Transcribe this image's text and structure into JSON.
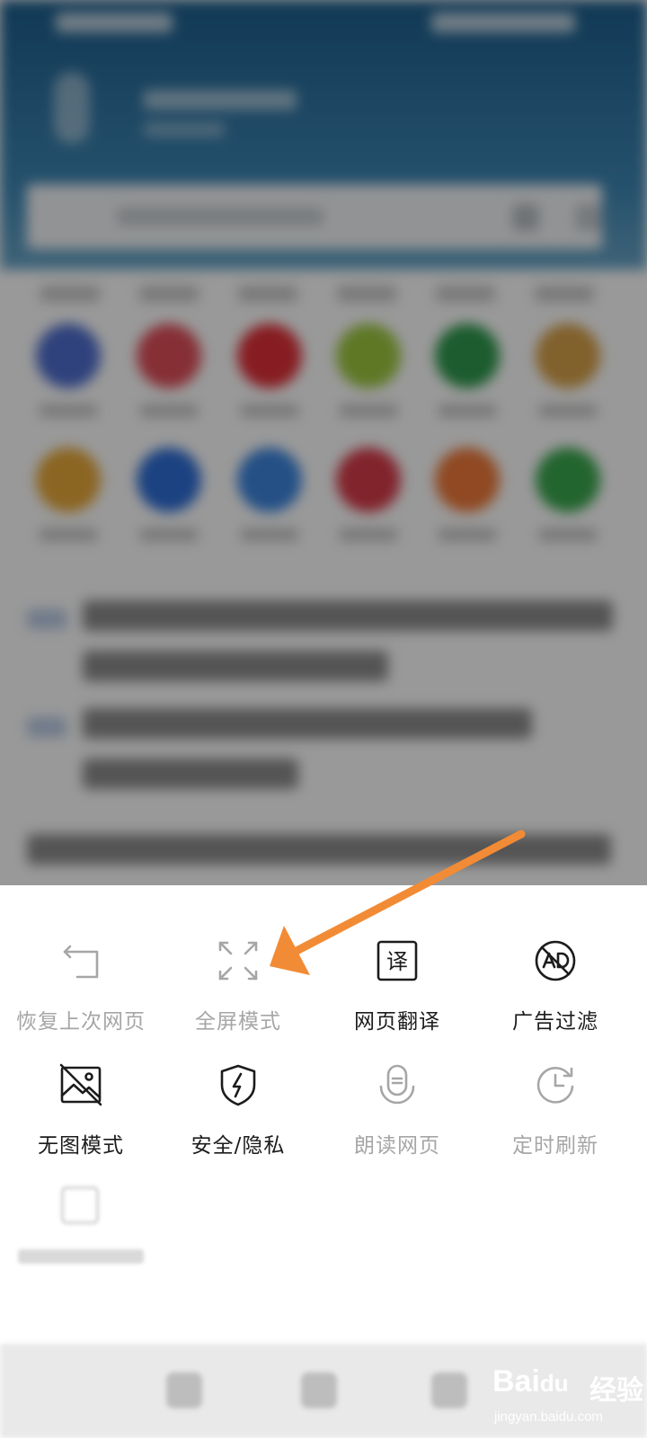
{
  "menu": {
    "items": [
      {
        "label": "恢复上次网页",
        "icon": "undo-arrow-icon",
        "enabled": false
      },
      {
        "label": "全屏模式",
        "icon": "fullscreen-icon",
        "enabled": false
      },
      {
        "label": "网页翻译",
        "icon": "translate-icon",
        "enabled": true
      },
      {
        "label": "广告过滤",
        "icon": "ad-block-icon",
        "enabled": true
      },
      {
        "label": "无图模式",
        "icon": "no-image-icon",
        "enabled": true
      },
      {
        "label": "安全/隐私",
        "icon": "security-shield-icon",
        "enabled": true
      },
      {
        "label": "朗读网页",
        "icon": "read-aloud-icon",
        "enabled": false
      },
      {
        "label": "定时刷新",
        "icon": "timed-refresh-icon",
        "enabled": false
      }
    ],
    "translate_glyph": "译"
  },
  "colors": {
    "annotation_arrow": "#f28b35",
    "active_text": "#1c1c1c",
    "inactive_text": "#a6a6a6"
  },
  "watermark": {
    "logo": "Bai",
    "logo_paw": "du",
    "brand": "经验",
    "url": "jingyan.baidu.com"
  }
}
